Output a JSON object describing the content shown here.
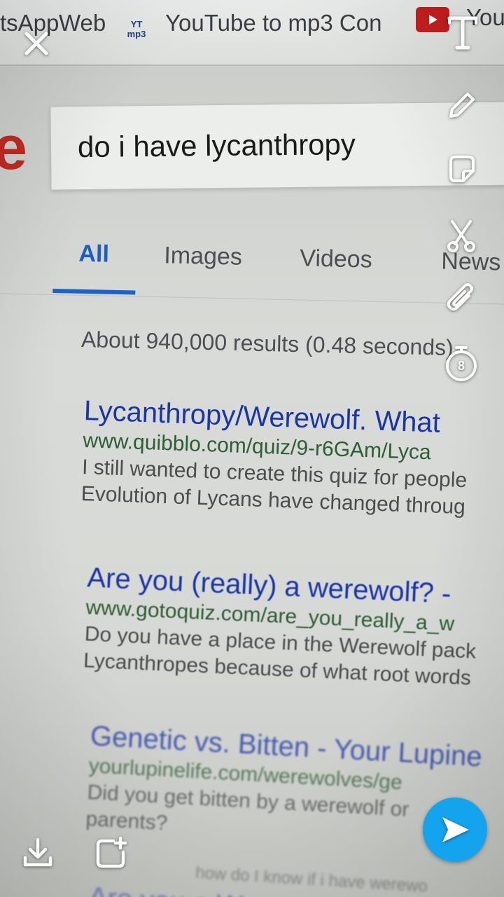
{
  "bookmarks": {
    "apps_label": "tsApp",
    "web_label": "Web",
    "yt_mp3_icon_text": "YT mp3",
    "youtube_mp3_label": "YouTube to mp3 Con",
    "youtube_label": "You"
  },
  "logo_fragment": "e",
  "search": {
    "query": "do i have lycanthropy"
  },
  "tabs": [
    {
      "label": "All",
      "active": true
    },
    {
      "label": "Images"
    },
    {
      "label": "Videos"
    },
    {
      "label": "News"
    }
  ],
  "results_stats": "About 940,000 results (0.48 seconds)",
  "results": [
    {
      "title": "Lycanthropy/Werewolf. What",
      "url": "www.quibblo.com/quiz/9-r6GAm/Lyca",
      "snippet": [
        "I still wanted to create this quiz for people",
        "Evolution of Lycans have changed throug"
      ]
    },
    {
      "title": "Are you (really) a werewolf? -",
      "url": "www.gotoquiz.com/are_you_really_a_w",
      "snippet": [
        "Do you have a place in the Werewolf pack",
        "Lycanthropes because of what root words"
      ]
    },
    {
      "title": "Genetic vs. Bitten - Your Lupine",
      "url": "yourlupinelife.com/werewolves/ge",
      "snippet": [
        "Did you get bitten by a werewolf or",
        "parents?"
      ]
    },
    {
      "title": "Are you a W",
      "url": "",
      "snippet": [
        "how do I know if i have werewo"
      ]
    }
  ],
  "overlay": {
    "timer_value": "8",
    "icons": [
      "close-icon",
      "text-tool-icon",
      "pencil-icon",
      "sticker-icon",
      "scissors-icon",
      "paperclip-icon",
      "timer-icon",
      "download-icon",
      "add-to-story-icon",
      "send-arrow-icon"
    ],
    "send_color": "#14a4ee"
  }
}
